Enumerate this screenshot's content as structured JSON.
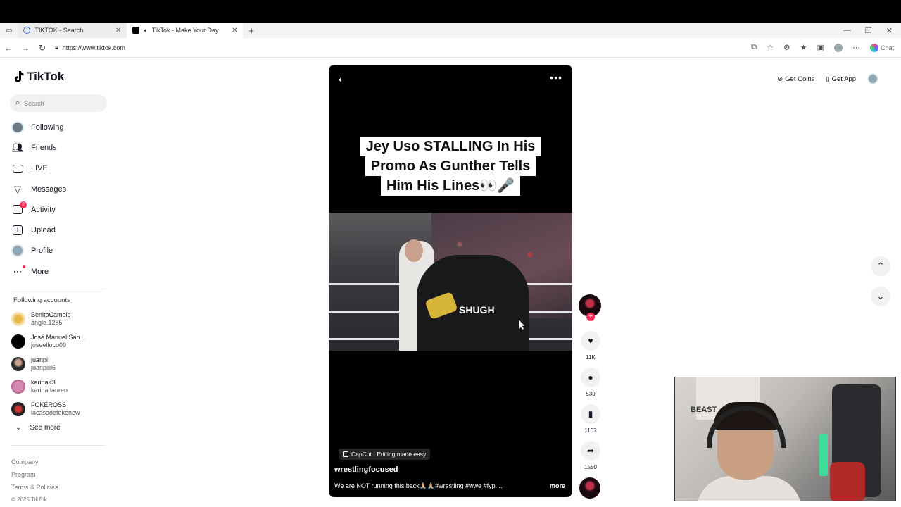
{
  "browser": {
    "tabs": [
      {
        "title": "TIKTOK - Search",
        "active": false
      },
      {
        "title": "TikTok - Make Your Day",
        "active": true
      }
    ],
    "url": "https://www.tiktok.com",
    "chat_label": "Chat"
  },
  "sidebar": {
    "logo": "TikTok",
    "search_placeholder": "Search",
    "nav": [
      {
        "label": "Following",
        "icon": "following-avatar-icon"
      },
      {
        "label": "Friends",
        "icon": "friends-icon"
      },
      {
        "label": "LIVE",
        "icon": "live-icon"
      },
      {
        "label": "Messages",
        "icon": "messages-icon"
      },
      {
        "label": "Activity",
        "icon": "activity-icon",
        "badge": "2"
      },
      {
        "label": "Upload",
        "icon": "upload-icon"
      },
      {
        "label": "Profile",
        "icon": "profile-avatar-icon"
      },
      {
        "label": "More",
        "icon": "more-icon"
      }
    ],
    "following_title": "Following accounts",
    "accounts": [
      {
        "name": "BenitoCamelo",
        "user": "angle.1285"
      },
      {
        "name": "José Manuel San...",
        "user": "joseelloco09"
      },
      {
        "name": "juanpi",
        "user": "juanpiiii6"
      },
      {
        "name": "karina<3",
        "user": "karina.lauren"
      },
      {
        "name": "FOKEROSS",
        "user": "lacasadefokenew"
      }
    ],
    "see_more": "See more",
    "footer": {
      "company": "Company",
      "program": "Program",
      "terms": "Terms & Policies",
      "copyright": "© 2025 TikTok"
    }
  },
  "header_right": {
    "get_coins": "Get Coins",
    "get_app": "Get App"
  },
  "video": {
    "caption_lines": [
      "Jey Uso STALLING In His",
      "Promo As Gunther Tells",
      "Him His Lines👀🎤"
    ],
    "shirt_text": "SHUGH",
    "capcut_label": "CapCut · Editing made easy",
    "author": "wrestlingfocused",
    "description": "We are NOT running this back🙏🏼🙏🏼#wrestling #wwe #fyp ...",
    "more_label": "more"
  },
  "actions": {
    "likes": "11K",
    "comments": "530",
    "saves": "1107",
    "shares": "1550"
  },
  "webcam": {
    "poster_text": "BEAST"
  }
}
